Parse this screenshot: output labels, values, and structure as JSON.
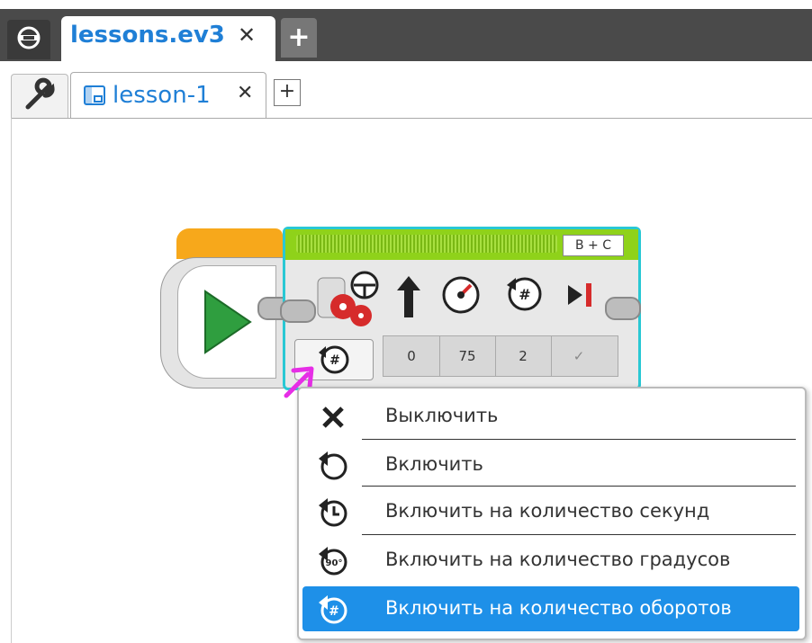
{
  "project_tabs": {
    "home_icon": "home-icon",
    "project_label": "lessons.ev3",
    "close": "✕",
    "add": "+"
  },
  "program_tabs": {
    "tools_icon": "wrench-icon",
    "program_label": "lesson-1",
    "close": "✕",
    "add": "+"
  },
  "move_block": {
    "ports": "B + C",
    "params": [
      "0",
      "75",
      "2",
      "✓"
    ]
  },
  "menu": {
    "items": [
      {
        "label": "Выключить",
        "icon": "off-x-icon"
      },
      {
        "label": "Включить",
        "icon": "on-icon"
      },
      {
        "label": "Включить на количество секунд",
        "icon": "seconds-icon"
      },
      {
        "label": "Включить на количество градусов",
        "icon": "degrees-icon"
      },
      {
        "label": "Включить на количество оборотов",
        "icon": "rotations-icon"
      }
    ],
    "selected_index": 4,
    "accent": "#1e90e8"
  },
  "colors": {
    "start_top": "#f7a81b",
    "move_top": "#8fd21a",
    "highlight": "#29c8d4",
    "pointer": "#e62ee6"
  }
}
